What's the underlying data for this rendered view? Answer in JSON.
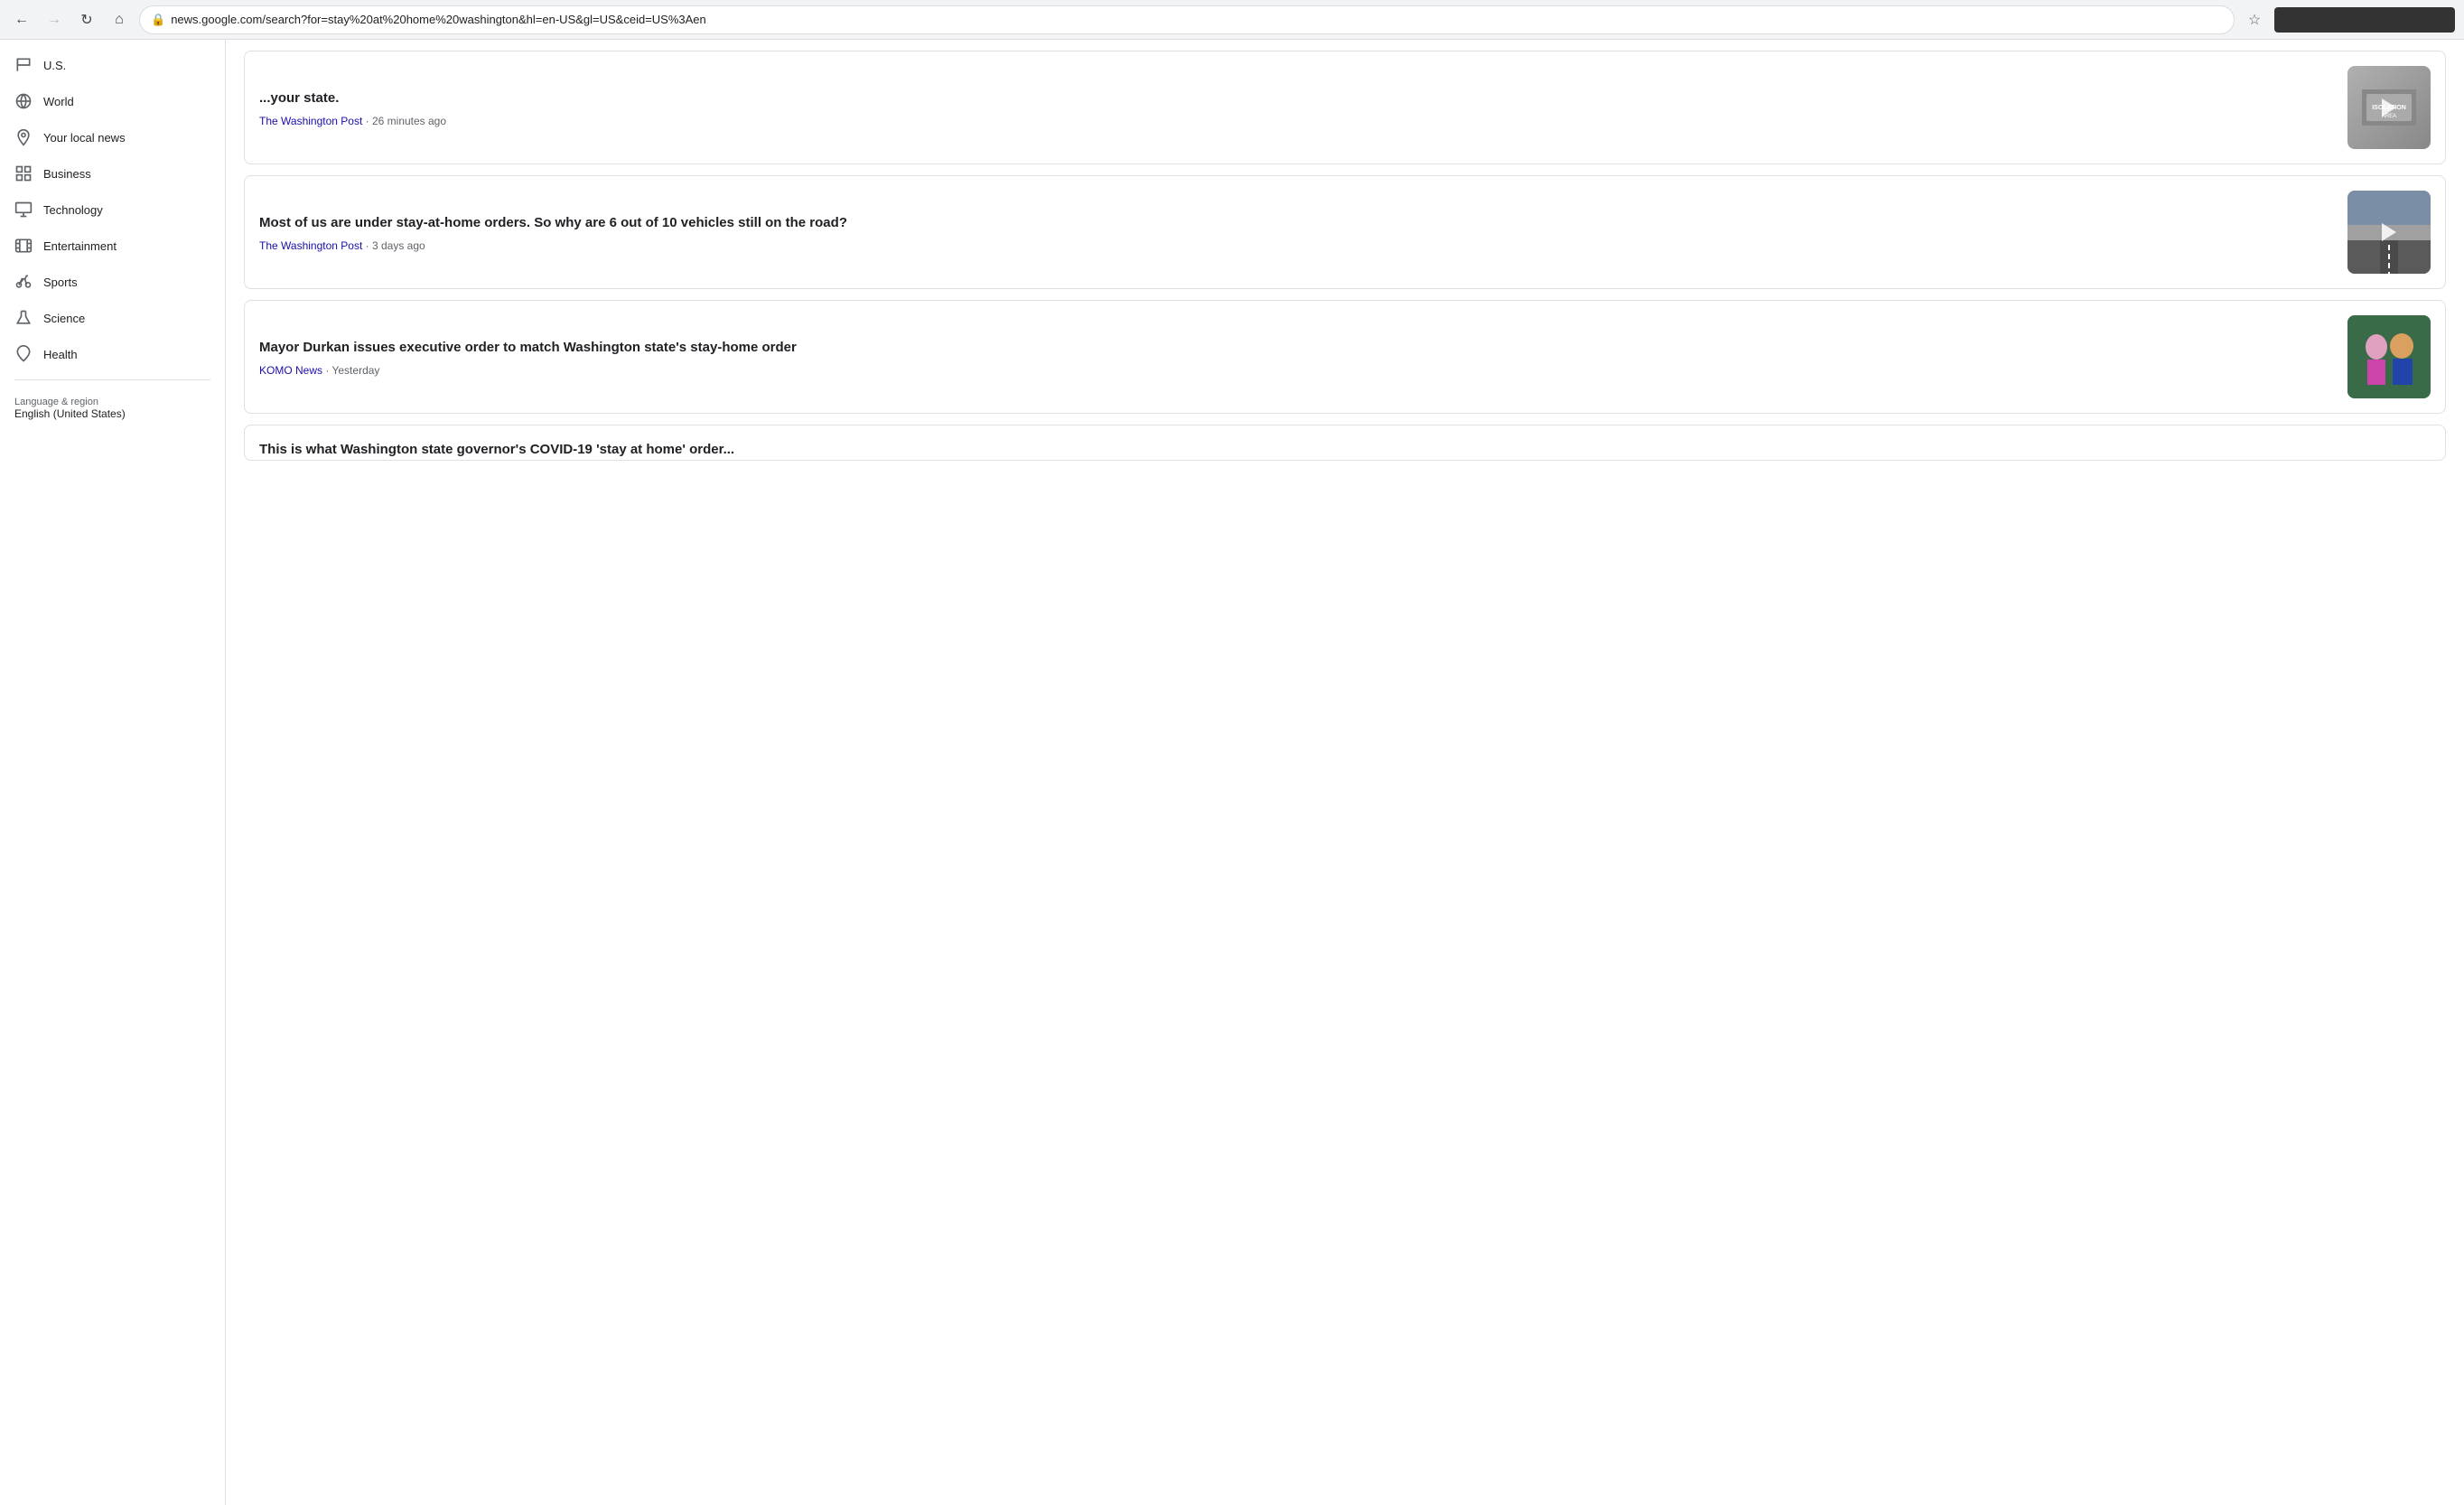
{
  "browser": {
    "url": "news.google.com/search?for=stay%20at%20home%20washington&hl=en-US&gl=US&ceid=US%3Aen",
    "back_disabled": false,
    "forward_disabled": true
  },
  "sidebar": {
    "items": [
      {
        "id": "us",
        "label": "U.S.",
        "icon": "flag"
      },
      {
        "id": "world",
        "label": "World",
        "icon": "globe"
      },
      {
        "id": "local-news",
        "label": "Your local news",
        "icon": "location"
      },
      {
        "id": "business",
        "label": "Business",
        "icon": "grid"
      },
      {
        "id": "technology",
        "label": "Technology",
        "icon": "tech"
      },
      {
        "id": "entertainment",
        "label": "Entertainment",
        "icon": "film"
      },
      {
        "id": "sports",
        "label": "Sports",
        "icon": "bike"
      },
      {
        "id": "science",
        "label": "Science",
        "icon": "flask"
      },
      {
        "id": "health",
        "label": "Health",
        "icon": "health"
      }
    ],
    "language_label": "Language & region",
    "language_value": "English (United States)"
  },
  "articles": [
    {
      "id": "article-1",
      "title": "...your state.",
      "source": "The Washington Post",
      "time": "26 minutes ago",
      "has_video": true,
      "thumb_type": "isolation"
    },
    {
      "id": "article-2",
      "title": "Most of us are under stay-at-home orders. So why are 6 out of 10 vehicles still on the road?",
      "source": "The Washington Post",
      "time": "3 days ago",
      "has_video": true,
      "thumb_type": "road"
    },
    {
      "id": "article-3",
      "title": "Mayor Durkan issues executive order to match Washington state's stay-home order",
      "source": "KOMO News",
      "time": "Yesterday",
      "has_video": false,
      "thumb_type": "durkan"
    },
    {
      "id": "article-4",
      "title": "This is what Washington state governor's COVID-19 'stay at home' order...",
      "source": "",
      "time": "",
      "has_video": false,
      "thumb_type": null
    }
  ]
}
